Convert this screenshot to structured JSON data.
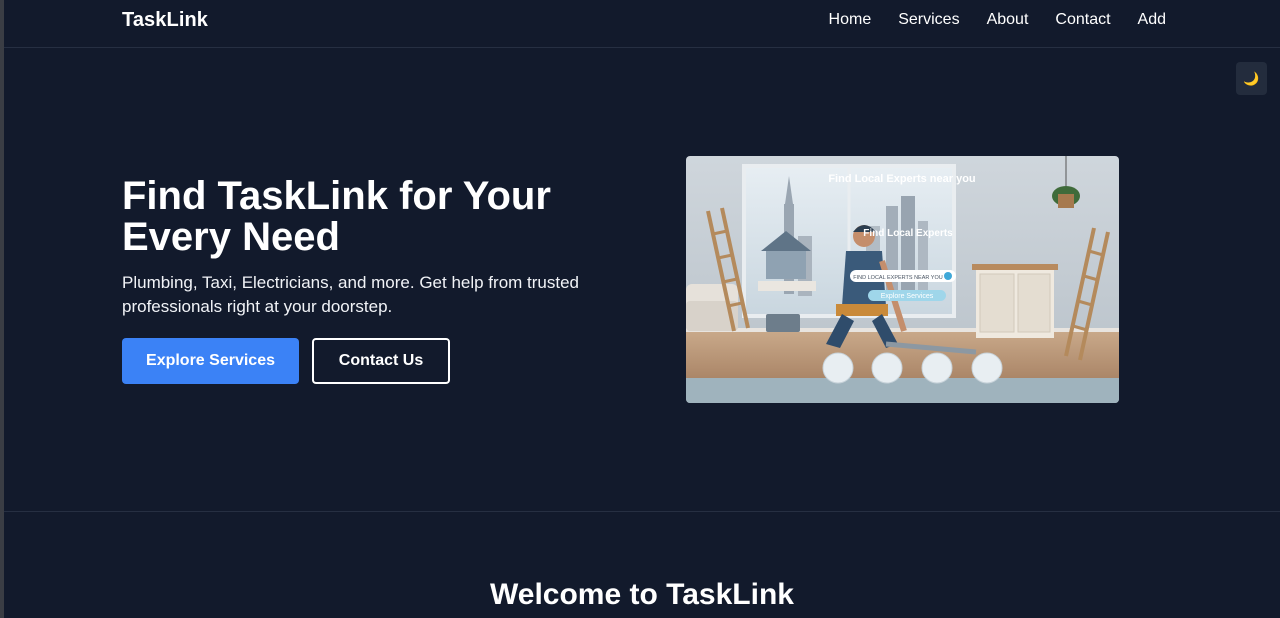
{
  "nav": {
    "brand": "TaskLink",
    "links": [
      "Home",
      "Services",
      "About",
      "Contact",
      "Add"
    ]
  },
  "theme_toggle": {
    "icon": "moon-icon",
    "glyph": "🌙"
  },
  "hero": {
    "title": "Find TaskLink for Your Every Need",
    "subtitle": "Plumbing, Taxi, Electricians, and more. Get help from trusted professionals right at your doorstep.",
    "primary_button": "Explore Services",
    "secondary_button": "Contact Us",
    "image": {
      "headline": "Find Local Experts near you",
      "subheadline": "Find Local Experts",
      "search_placeholder": "FIND LOCAL EXPERTS NEAR YOU",
      "button": "Explore Services"
    }
  },
  "section": {
    "title": "Welcome to TaskLink"
  },
  "colors": {
    "background": "#121a2c",
    "accent": "#3b82f6",
    "text": "#ffffff"
  }
}
